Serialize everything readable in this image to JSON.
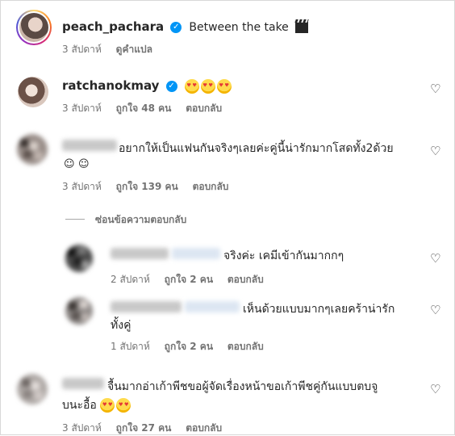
{
  "post": {
    "username": "peach_pachara",
    "caption": "Between the take",
    "time": "3 สัปดาห์",
    "translate": "ดูคำแปล"
  },
  "comments": [
    {
      "username": "ratchanokmay",
      "time": "3 สัปดาห์",
      "likes": "ถูกใจ 48 คน",
      "reply": "ตอบกลับ"
    },
    {
      "text": "อยากให้เป็นแฟนกันจริงๆเลยค่ะคู่นี้น่ารักมากโสดทั้ง2ด้วย",
      "time": "3 สัปดาห์",
      "likes": "ถูกใจ 139 คน",
      "reply": "ตอบกลับ"
    },
    {
      "text": "จื้นมากอ่าเก้าพีชขอผู้จัดเรื่องหน้าขอเก้าพีชคู่กันแบบตบจู",
      "text2": "บนะอื้อ",
      "time": "3 สัปดาห์",
      "likes": "ถูกใจ 27 คน",
      "reply": "ตอบกลับ"
    }
  ],
  "hide_replies": "ซ่อนข้อความตอบกลับ",
  "replies": [
    {
      "text": "จริงค่ะ เคมีเข้ากันมากกๆ",
      "time": "2 สัปดาห์",
      "likes": "ถูกใจ 2 คน",
      "reply": "ตอบกลับ"
    },
    {
      "text": "เห็นด้วยแบบมากๆเลยคร้าน่ารัก",
      "text2": "ทั้งคู่",
      "time": "1 สัปดาห์",
      "likes": "ถูกใจ 2 คน",
      "reply": "ตอบกลับ"
    }
  ],
  "icons": {
    "verified": "verified-badge-icon",
    "heart": "heart-outline-icon",
    "clapper": "clapper-board-emoji",
    "heart_eyes": "heart-eyes-emoji",
    "smile": "smiling-face-emoji"
  },
  "colors": {
    "verified": "#0095f6",
    "meta": "#737373",
    "text": "#262626"
  }
}
